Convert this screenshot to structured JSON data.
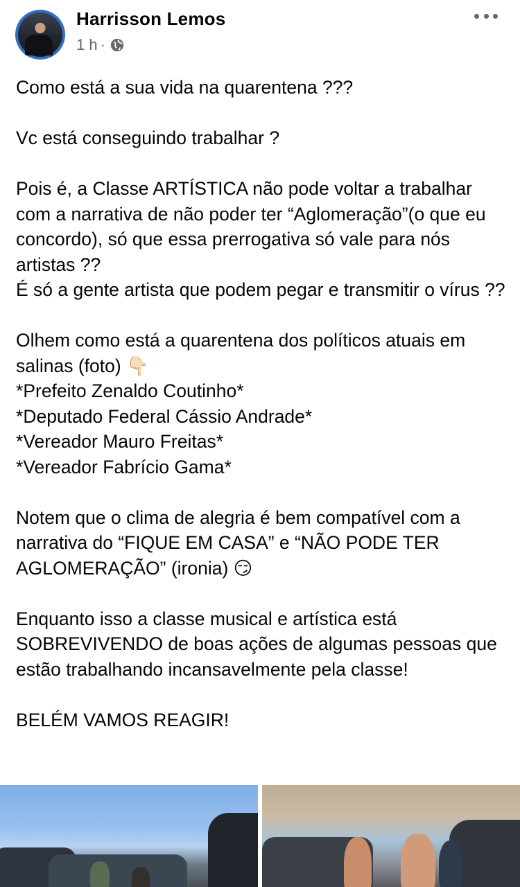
{
  "post": {
    "author": "Harrisson Lemos",
    "time": "1 h",
    "separator": "·",
    "privacy_icon": "globe-icon",
    "more_icon": "more-options-icon",
    "paragraphs": [
      "Como está a sua vida na quarentena ???",
      "Vc está conseguindo trabalhar ?",
      "Pois é, a Classe ARTÍSTICA não pode voltar a trabalhar com a narrativa de não poder ter “Aglomeração”(o que eu concordo), só que essa prerrogativa só vale para nós artistas ??\nÉ só a gente artista que podem pegar e transmitir o vírus ??",
      "Olhem como está a quarentena dos políticos atuais em salinas (foto) 👇🏻\n*Prefeito Zenaldo Coutinho*\n*Deputado Federal Cássio Andrade*\n*Vereador Mauro Freitas*\n*Vereador Fabrício Gama*",
      "Notem que o clima de alegria é bem compatível com a narrativa do “FIQUE EM CASA” e “NÃO PODE TER AGLOMERAÇÃO” (ironia) 😏",
      "Enquanto isso a classe musical e artística está SOBREVIVENDO de boas ações de algumas pessoas que estão trabalhando incansavelmente pela classe!",
      "BELÉM VAMOS REAGIR!"
    ]
  },
  "colors": {
    "secondary_text": "#65676b",
    "text": "#050505"
  }
}
